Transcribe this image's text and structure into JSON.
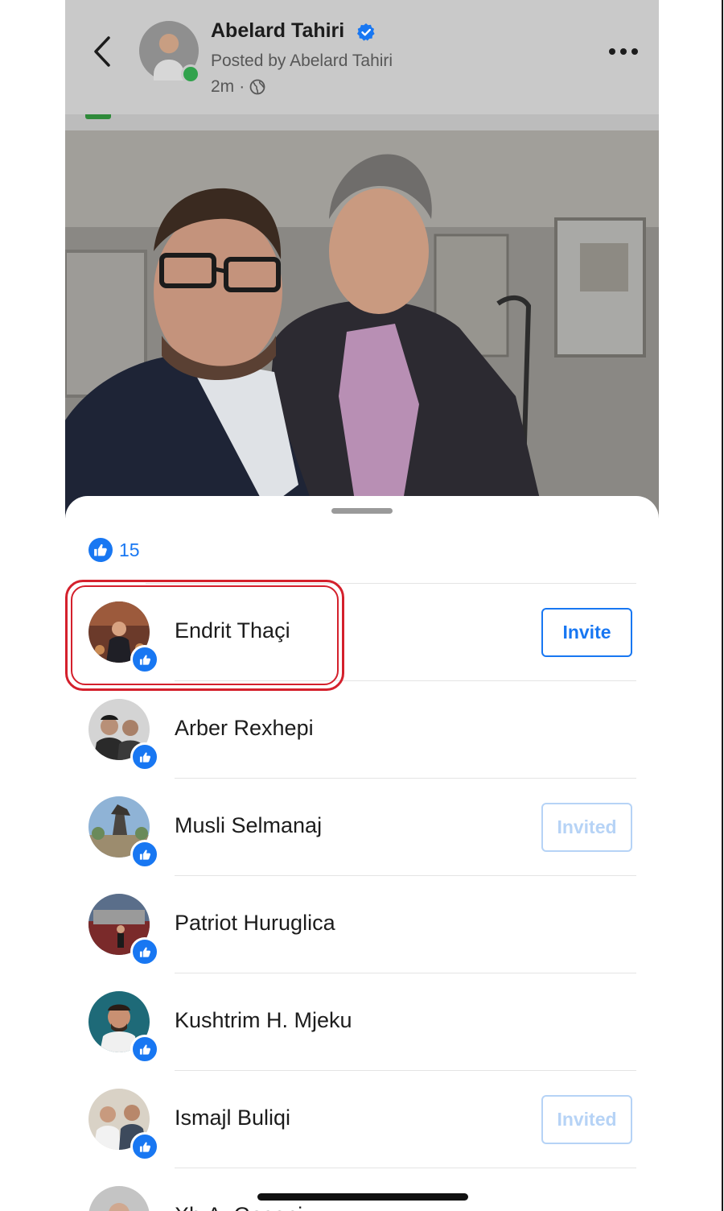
{
  "header": {
    "author_name": "Abelard Tahiri",
    "posted_by": "Posted by Abelard Tahiri",
    "time": "2m",
    "time_separator": "·"
  },
  "reactions": {
    "count": "15"
  },
  "people": [
    {
      "name": "Endrit Thaçi",
      "button": "Invite"
    },
    {
      "name": "Arber Rexhepi",
      "button": ""
    },
    {
      "name": "Musli Selmanaj",
      "button": "Invited"
    },
    {
      "name": "Patriot Huruglica",
      "button": ""
    },
    {
      "name": "Kushtrim H. Mjeku",
      "button": ""
    },
    {
      "name": "Ismajl Buliqi",
      "button": "Invited"
    },
    {
      "name": "Xh.A. Gasani",
      "button": ""
    }
  ],
  "colors": {
    "facebook_blue": "#1877f2",
    "invited_blue": "#b6d3f6",
    "highlight_red": "#d4202c",
    "online_green": "#31a24c"
  },
  "icons": [
    "back-chevron-icon",
    "verified-badge-icon",
    "globe-icon",
    "more-dots-icon",
    "thumbs-up-icon"
  ]
}
